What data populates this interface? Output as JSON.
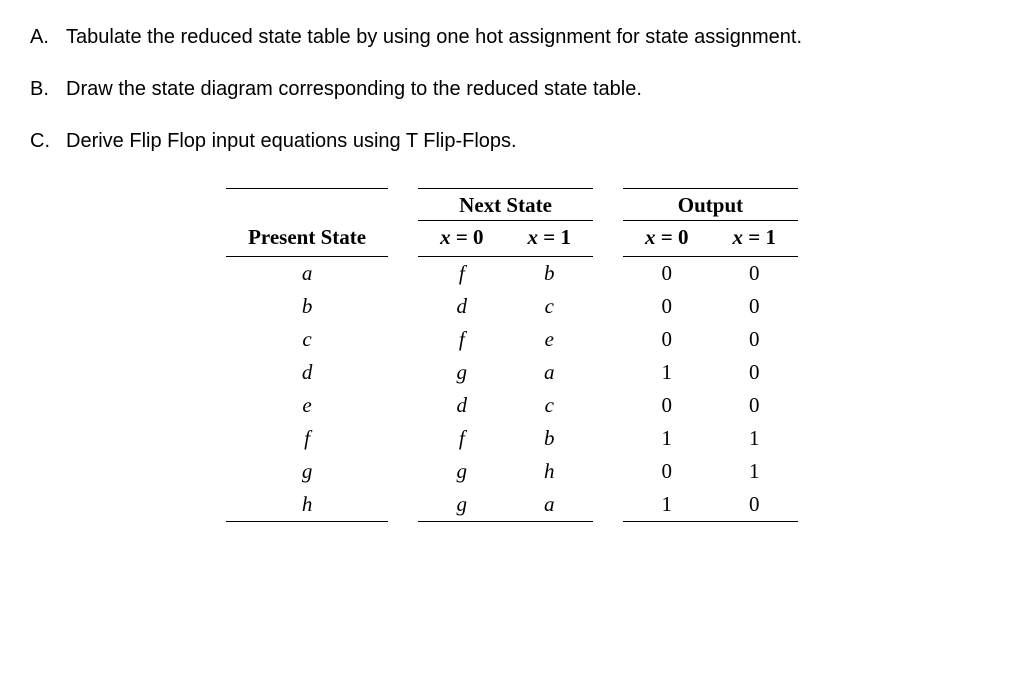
{
  "questions": [
    {
      "label": "A.",
      "text": "Tabulate the reduced state table by using one hot assignment for state assignment."
    },
    {
      "label": "B.",
      "text": "Draw the state diagram corresponding to the reduced state table."
    },
    {
      "label": "C.",
      "text": "Derive Flip Flop input equations using T Flip-Flops."
    }
  ],
  "table": {
    "headers": {
      "present_state": "Present State",
      "next_state": "Next State",
      "output": "Output",
      "x0": "x = 0",
      "x1": "x = 1"
    },
    "rows": [
      {
        "ps": "a",
        "ns0": "f",
        "ns1": "b",
        "out0": "0",
        "out1": "0"
      },
      {
        "ps": "b",
        "ns0": "d",
        "ns1": "c",
        "out0": "0",
        "out1": "0"
      },
      {
        "ps": "c",
        "ns0": "f",
        "ns1": "e",
        "out0": "0",
        "out1": "0"
      },
      {
        "ps": "d",
        "ns0": "g",
        "ns1": "a",
        "out0": "1",
        "out1": "0"
      },
      {
        "ps": "e",
        "ns0": "d",
        "ns1": "c",
        "out0": "0",
        "out1": "0"
      },
      {
        "ps": "f",
        "ns0": "f",
        "ns1": "b",
        "out0": "1",
        "out1": "1"
      },
      {
        "ps": "g",
        "ns0": "g",
        "ns1": "h",
        "out0": "0",
        "out1": "1"
      },
      {
        "ps": "h",
        "ns0": "g",
        "ns1": "a",
        "out0": "1",
        "out1": "0"
      }
    ]
  },
  "chart_data": {
    "type": "table",
    "title": "State Table",
    "columns": [
      "Present State",
      "Next State (x=0)",
      "Next State (x=1)",
      "Output (x=0)",
      "Output (x=1)"
    ],
    "rows": [
      [
        "a",
        "f",
        "b",
        0,
        0
      ],
      [
        "b",
        "d",
        "c",
        0,
        0
      ],
      [
        "c",
        "f",
        "e",
        0,
        0
      ],
      [
        "d",
        "g",
        "a",
        1,
        0
      ],
      [
        "e",
        "d",
        "c",
        0,
        0
      ],
      [
        "f",
        "f",
        "b",
        1,
        1
      ],
      [
        "g",
        "g",
        "h",
        0,
        1
      ],
      [
        "h",
        "g",
        "a",
        1,
        0
      ]
    ]
  }
}
